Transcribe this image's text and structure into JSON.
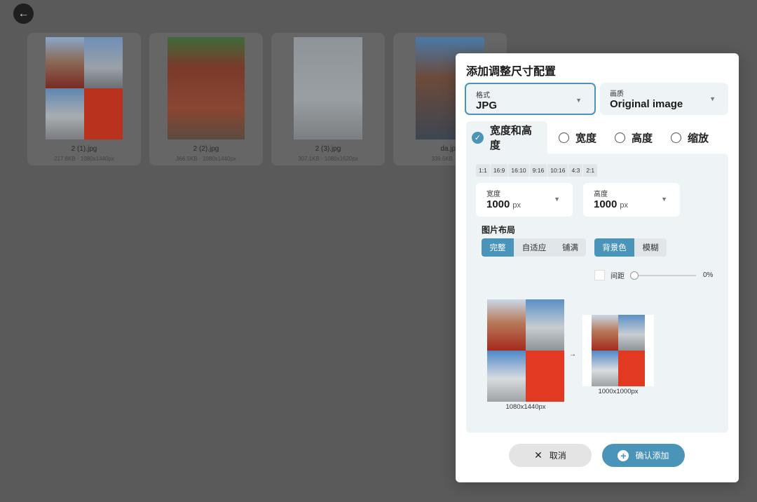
{
  "back_icon": "arrow-left-icon",
  "gallery": [
    {
      "name": "2 (1).jpg",
      "meta": "217.8KB · 1080x1440px"
    },
    {
      "name": "2 (2).jpg",
      "meta": "366.5KB · 1080x1440px"
    },
    {
      "name": "2 (3).jpg",
      "meta": "307.1KB · 1080x1620px"
    },
    {
      "name": "da.jpg",
      "meta": "339.6KB · 10..."
    }
  ],
  "modal": {
    "title": "添加调整尺寸配置",
    "format": {
      "label": "格式",
      "value": "JPG"
    },
    "quality": {
      "label": "画质",
      "value": "Original image"
    },
    "tabs": [
      "宽度和高度",
      "宽度",
      "高度",
      "缩放"
    ],
    "active_tab": "宽度和高度",
    "ratios": [
      "1:1",
      "16:9",
      "16:10",
      "9:16",
      "10:16",
      "4:3",
      "2:1"
    ],
    "width": {
      "label": "宽度",
      "value": "1000",
      "unit": "px"
    },
    "height": {
      "label": "高度",
      "value": "1000",
      "unit": "px"
    },
    "layout_title": "图片布局",
    "layout_modes": [
      "完整",
      "自适应",
      "铺满"
    ],
    "active_layout": "完整",
    "fill_modes": [
      "背景色",
      "模糊"
    ],
    "active_fill": "背景色",
    "spacing": {
      "label": "间距",
      "value": "0%",
      "level": 0
    },
    "preview": {
      "source_size": "1080x1440px",
      "target_size": "1000x1000px"
    },
    "cancel_label": "取消",
    "confirm_label": "确认添加"
  },
  "colors": {
    "accent": "#4a94ba",
    "panel": "#eef3f6",
    "overlay": "#5a5a5a"
  }
}
